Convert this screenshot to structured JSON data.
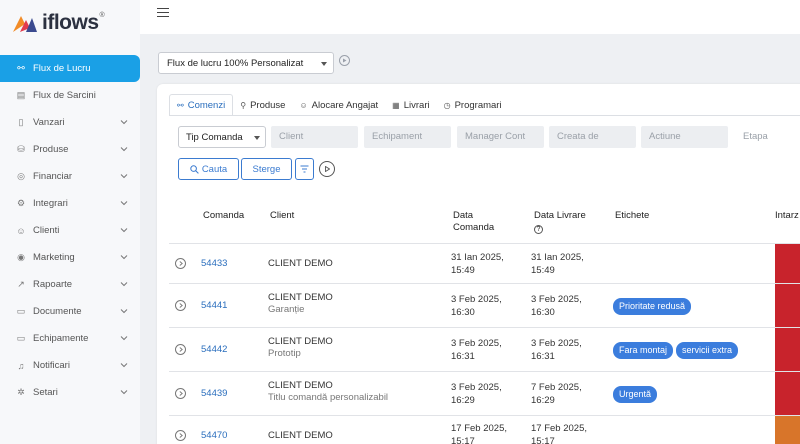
{
  "brand": {
    "name": "iflows",
    "registered": "®"
  },
  "sidebar": {
    "items": [
      {
        "label": "Flux de Lucru",
        "icon": "workflow-icon",
        "active": true,
        "expandable": false
      },
      {
        "label": "Flux de Sarcini",
        "icon": "tasks-icon",
        "active": false,
        "expandable": false
      },
      {
        "label": "Vanzari",
        "icon": "sales-icon",
        "active": false,
        "expandable": true
      },
      {
        "label": "Produse",
        "icon": "products-icon",
        "active": false,
        "expandable": true
      },
      {
        "label": "Financiar",
        "icon": "finance-icon",
        "active": false,
        "expandable": true
      },
      {
        "label": "Integrari",
        "icon": "integrations-icon",
        "active": false,
        "expandable": true
      },
      {
        "label": "Clienti",
        "icon": "clients-icon",
        "active": false,
        "expandable": true
      },
      {
        "label": "Marketing",
        "icon": "marketing-icon",
        "active": false,
        "expandable": true
      },
      {
        "label": "Rapoarte",
        "icon": "reports-icon",
        "active": false,
        "expandable": true
      },
      {
        "label": "Documente",
        "icon": "documents-icon",
        "active": false,
        "expandable": true
      },
      {
        "label": "Echipamente",
        "icon": "equipment-icon",
        "active": false,
        "expandable": true
      },
      {
        "label": "Notificari",
        "icon": "bell-icon",
        "active": false,
        "expandable": true
      },
      {
        "label": "Setari",
        "icon": "gear-icon",
        "active": false,
        "expandable": true
      }
    ]
  },
  "flow_select": {
    "value": "Flux de lucru 100% Personalizat"
  },
  "tabs": [
    {
      "label": "Comenzi",
      "icon": "orders-icon",
      "active": true
    },
    {
      "label": "Produse",
      "icon": "products-icon",
      "active": false
    },
    {
      "label": "Alocare Angajat",
      "icon": "employees-icon",
      "active": false
    },
    {
      "label": "Livrari",
      "icon": "calendar-icon",
      "active": false
    },
    {
      "label": "Programari",
      "icon": "clock-icon",
      "active": false
    }
  ],
  "filters": {
    "type_select": "Tip Comanda",
    "client": "Client",
    "equipment": "Echipament",
    "manager": "Manager Cont",
    "created_by": "Creata de",
    "action": "Actiune",
    "stage": "Etapa"
  },
  "buttons": {
    "search": "Cauta",
    "clear": "Sterge"
  },
  "table": {
    "columns": {
      "order": "Comanda",
      "client": "Client",
      "order_date": "Data Comanda",
      "delivery_date": "Data Livrare",
      "tags": "Etichete",
      "delay": "Intarz"
    },
    "rows": [
      {
        "order": "54433",
        "client": "CLIENT DEMO",
        "sub": "",
        "order_date": "31 Ian 2025, 15:49",
        "delivery_date": "31 Ian 2025, 15:49",
        "tags": [],
        "status_color": "#c8232c"
      },
      {
        "order": "54441",
        "client": "CLIENT DEMO",
        "sub": "Garanție",
        "order_date": "3 Feb 2025, 16:30",
        "delivery_date": "3 Feb 2025, 16:30",
        "tags": [
          "Prioritate redusă"
        ],
        "status_color": "#c8232c"
      },
      {
        "order": "54442",
        "client": "CLIENT DEMO",
        "sub": "Prototip",
        "order_date": "3 Feb 2025, 16:31",
        "delivery_date": "3 Feb 2025, 16:31",
        "tags": [
          "Fara montaj",
          "servicii extra"
        ],
        "status_color": "#c8232c"
      },
      {
        "order": "54439",
        "client": "CLIENT DEMO",
        "sub": "Titlu comandă personalizabil",
        "order_date": "3 Feb 2025, 16:29",
        "delivery_date": "7 Feb 2025, 16:29",
        "tags": [
          "Urgentă"
        ],
        "status_color": "#c8232c"
      },
      {
        "order": "54470",
        "client": "CLIENT DEMO",
        "sub": "",
        "order_date": "17 Feb 2025, 15:17",
        "delivery_date": "17 Feb 2025, 15:17",
        "tags": [],
        "status_color": "#d8752a"
      }
    ]
  },
  "colors": {
    "accent": "#1aa0e6",
    "link": "#2a6ebd",
    "tag": "#3b7ddd",
    "danger": "#c8232c",
    "warning": "#d8752a"
  }
}
